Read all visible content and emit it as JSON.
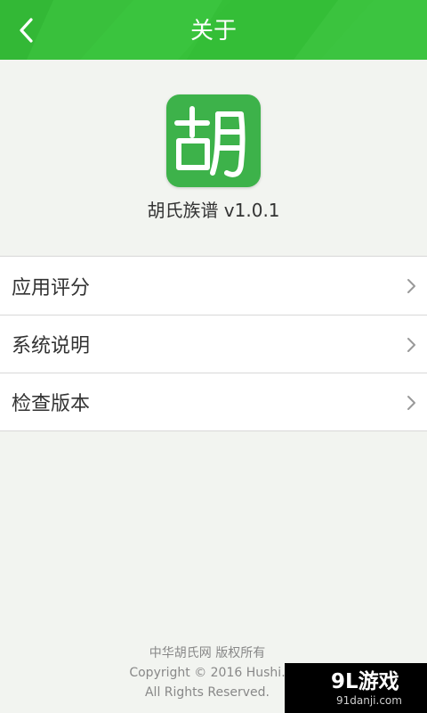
{
  "header": {
    "title": "关于",
    "back_icon": "chevron-left-icon",
    "color": "#37c13a"
  },
  "app": {
    "logo_char": "胡",
    "logo_color": "#3db24a",
    "version_text": "胡氏族谱 v1.0.1"
  },
  "menu": {
    "items": [
      {
        "label": "应用评分",
        "icon": "chevron-right-icon"
      },
      {
        "label": "系统说明",
        "icon": "chevron-right-icon"
      },
      {
        "label": "检查版本",
        "icon": "chevron-right-icon"
      }
    ]
  },
  "footer": {
    "line1": "中华胡氏网 版权所有",
    "line2": "Copyright © 2016 Hushi.",
    "line3": "All Rights Reserved."
  },
  "watermark": {
    "main": "9L游戏",
    "sub": "91danji.com"
  }
}
